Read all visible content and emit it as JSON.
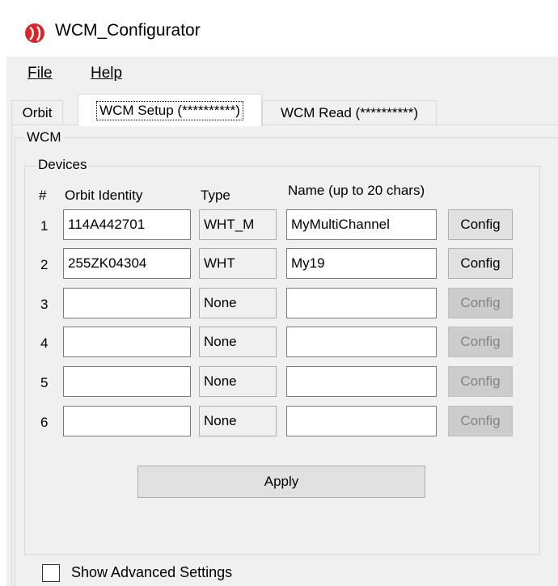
{
  "window": {
    "title": "WCM_Configurator"
  },
  "menu": {
    "file": "File",
    "help": "Help"
  },
  "tabs": [
    {
      "label": "Orbit"
    },
    {
      "label": "WCM Setup (**********)"
    },
    {
      "label": "WCM Read (**********)"
    }
  ],
  "wcm_group": {
    "title": "WCM"
  },
  "devices_group": {
    "title": "Devices",
    "headers": {
      "num": "#",
      "identity": "Orbit Identity",
      "type": "Type",
      "name": "Name (up to 20 chars)"
    },
    "rows": [
      {
        "num": "1",
        "identity": "114A442701",
        "type": "WHT_M",
        "name": "MyMultiChannel",
        "config": "Config",
        "config_enabled": true
      },
      {
        "num": "2",
        "identity": "255ZK04304",
        "type": "WHT",
        "name": "My19",
        "config": "Config",
        "config_enabled": true
      },
      {
        "num": "3",
        "identity": "",
        "type": "None",
        "name": "",
        "config": "Config",
        "config_enabled": false
      },
      {
        "num": "4",
        "identity": "",
        "type": "None",
        "name": "",
        "config": "Config",
        "config_enabled": false
      },
      {
        "num": "5",
        "identity": "",
        "type": "None",
        "name": "",
        "config": "Config",
        "config_enabled": false
      },
      {
        "num": "6",
        "identity": "",
        "type": "None",
        "name": "",
        "config": "Config",
        "config_enabled": false
      }
    ]
  },
  "apply_button": "Apply",
  "advanced": {
    "label": "Show Advanced Settings",
    "checked": false
  },
  "icons": {
    "app": "red-sphere-logo-icon"
  }
}
